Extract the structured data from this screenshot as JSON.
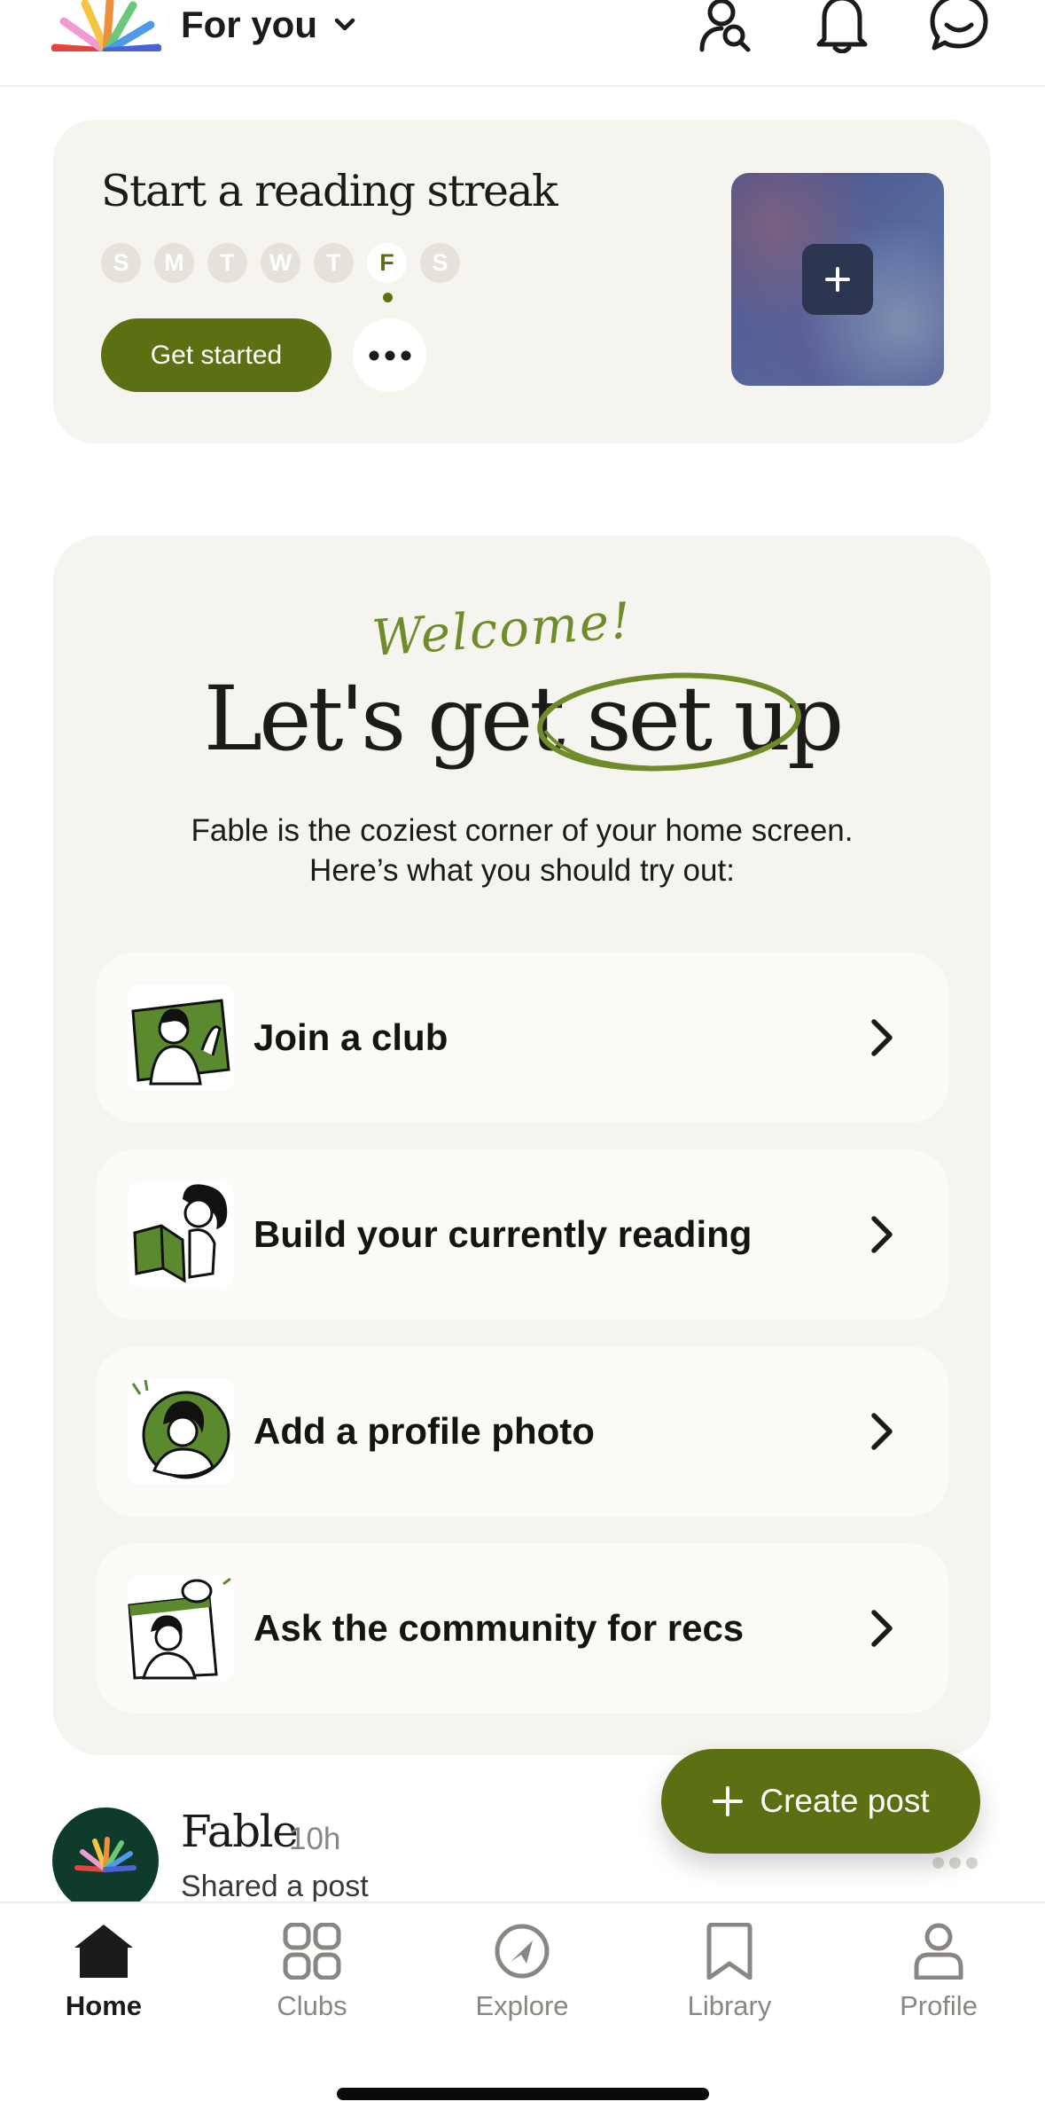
{
  "header": {
    "feed_title": "For you",
    "icons": [
      "fable-logo",
      "chevron-down-icon",
      "find-people-icon",
      "bell-icon",
      "chat-icon"
    ]
  },
  "streak": {
    "title": "Start a reading streak",
    "days": [
      "S",
      "M",
      "T",
      "W",
      "T",
      "F",
      "S"
    ],
    "active_day_index": 5,
    "button_label": "Get started"
  },
  "setup": {
    "welcome": "Welcome!",
    "title": "Let's get set up",
    "description_line1": "Fable is the coziest corner of your home screen.",
    "description_line2": "Here’s what you should try out:",
    "tasks": [
      {
        "label": "Join a club"
      },
      {
        "label": "Build your currently reading"
      },
      {
        "label": "Add a profile photo"
      },
      {
        "label": "Ask the community for recs"
      }
    ]
  },
  "fab": {
    "label": "Create post"
  },
  "post": {
    "author": "Fable",
    "time": "10h",
    "subtitle": "Shared a post"
  },
  "tabs": [
    {
      "label": "Home",
      "active": true
    },
    {
      "label": "Clubs",
      "active": false
    },
    {
      "label": "Explore",
      "active": false
    },
    {
      "label": "Library",
      "active": false
    },
    {
      "label": "Profile",
      "active": false
    }
  ],
  "colors": {
    "accent": "#5b7012",
    "welcome": "#6e8c2a",
    "card": "#f6f4ef"
  }
}
